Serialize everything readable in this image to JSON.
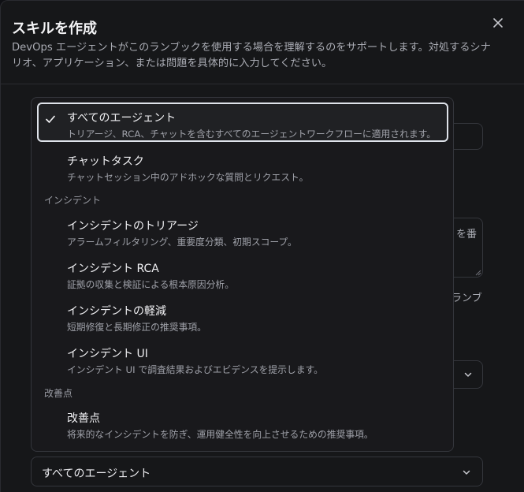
{
  "dialog": {
    "title": "スキルを作成",
    "subtitle": "DevOps エージェントがこのランブックを使用する場合を理解するのをサポートします。対処するシナリオ、アプリケーション、または問題を具体的に入力してください。",
    "close_icon": "close-icon"
  },
  "background": {
    "partial_text_1": "を番",
    "partial_text_2": "ランブ"
  },
  "dropdown": {
    "options_top": [
      {
        "label": "すべてのエージェント",
        "description": "トリアージ、RCA、チャットを含むすべてのエージェントワークフローに適用されます。",
        "selected": true
      },
      {
        "label": "チャットタスク",
        "description": "チャットセッション中のアドホックな質問とリクエスト。",
        "selected": false
      }
    ],
    "group_incident": "インシデント",
    "options_incident": [
      {
        "label": "インシデントのトリアージ",
        "description": "アラームフィルタリング、重要度分類、初期スコープ。"
      },
      {
        "label": "インシデント RCA",
        "description": "証拠の収集と検証による根本原因分析。"
      },
      {
        "label": "インシデントの軽減",
        "description": "短期修復と長期修正の推奨事項。"
      },
      {
        "label": "インシデント UI",
        "description": "インシデント UI で調査結果およびエビデンスを提示します。"
      }
    ],
    "group_improvement": "改善点",
    "options_improvement": [
      {
        "label": "改善点",
        "description": "将来的なインシデントを防ぎ、運用健全性を向上させるための推奨事項。"
      }
    ]
  },
  "agent_select": {
    "value": "すべてのエージェント"
  }
}
